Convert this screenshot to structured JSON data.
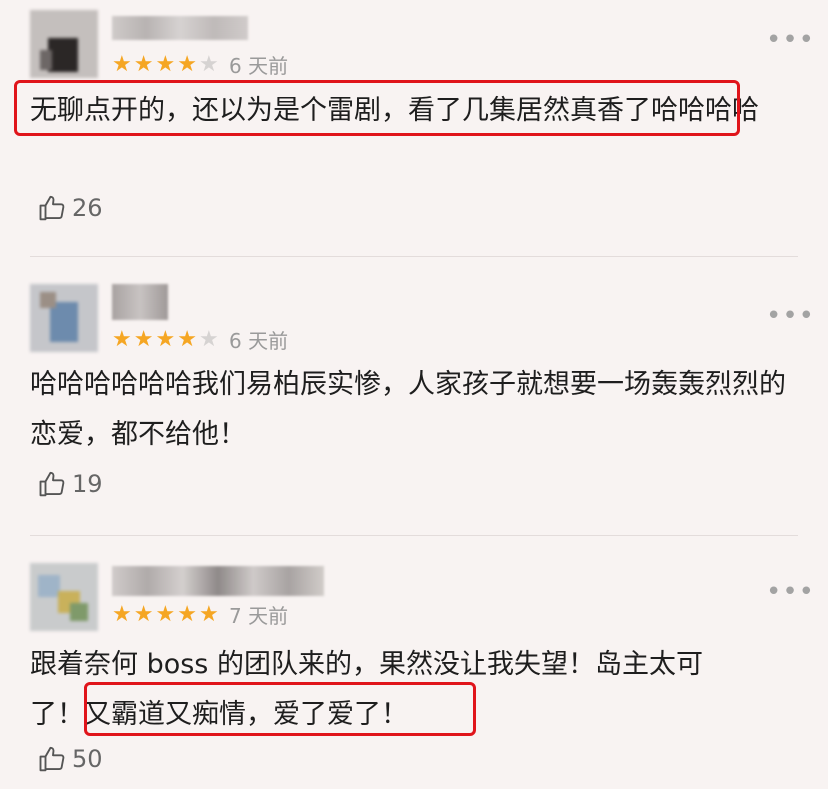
{
  "comments": [
    {
      "stars": 4,
      "time": "6 天前",
      "text": "无聊点开的，还以为是个雷剧，看了几集居然真香了哈哈哈哈",
      "likes": "26",
      "avatar_colors": [
        "#b9b4b2",
        "#5a5554",
        "#2b2726",
        "#d9d4d3"
      ],
      "highlighted": true
    },
    {
      "stars": 4,
      "time": "6 天前",
      "text": "哈哈哈哈哈哈我们易柏辰实惨，人家孩子就想要一场轰轰烈烈的恋爱，都不给他！",
      "likes": "19",
      "avatar_colors": [
        "#a8b0b8",
        "#7d8fa2",
        "#6a8cb2",
        "#c7c5c8"
      ],
      "highlighted": false
    },
    {
      "stars": 5,
      "time": "7 天前",
      "text_line1": "跟着奈何 boss 的团队来的，果然没让我失望！岛主太可",
      "text_line2_pre": "了！",
      "text_line2_highlight": "又霸道又痴情，爱了爱了！",
      "likes": "50",
      "avatar_colors": [
        "#9fb4c8",
        "#c9b15b",
        "#7f9a6a",
        "#c8c7c6"
      ],
      "highlighted": true
    }
  ],
  "colors": {
    "background": "#f8f3f2",
    "star_on": "#f5a623",
    "star_off": "#d6d3d2",
    "highlight_box": "#e0141b",
    "muted_text": "#9a9a9a"
  }
}
